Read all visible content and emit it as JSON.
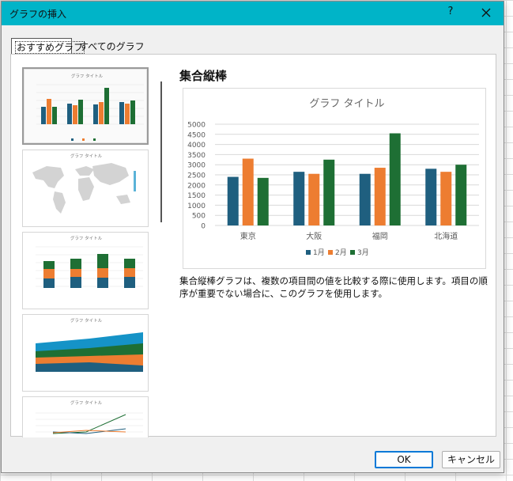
{
  "dialog": {
    "title": "グラフの挿入",
    "help": "?",
    "tabs": [
      "おすすめグラフ",
      "すべてのグラフ"
    ]
  },
  "thumbnails": [
    {
      "title": "グラフ タイトル",
      "kind": "clustered-column"
    },
    {
      "title": "グラフ タイトル",
      "kind": "map"
    },
    {
      "title": "グラフ タイトル",
      "kind": "stacked-column"
    },
    {
      "title": "グラフ タイトル",
      "kind": "stacked-area"
    },
    {
      "title": "グラフ タイトル",
      "kind": "line"
    }
  ],
  "detail": {
    "heading": "集合縦棒",
    "description": "集合縦棒グラフは、複数の項目間の値を比較する際に使用します。項目の順序が重要でない場合に、このグラフを使用します。"
  },
  "chart_data": {
    "type": "bar",
    "title": "グラフ タイトル",
    "categories": [
      "東京",
      "大阪",
      "福岡",
      "北海道"
    ],
    "series": [
      {
        "name": "1月",
        "color": "#1f5f7f",
        "values": [
          2400,
          2650,
          2550,
          2800
        ]
      },
      {
        "name": "2月",
        "color": "#ed7d31",
        "values": [
          3300,
          2550,
          2850,
          2650
        ]
      },
      {
        "name": "3月",
        "color": "#1e6f34",
        "values": [
          2350,
          3250,
          4550,
          3000
        ]
      }
    ],
    "ylim": [
      0,
      5000
    ],
    "yticks": [
      "5000",
      "4500",
      "4000",
      "3500",
      "3000",
      "2500",
      "2000",
      "1500",
      "1000",
      "500",
      "0"
    ],
    "grid": true,
    "legend": "bottom"
  },
  "buttons": {
    "ok": "OK",
    "cancel": "キャンセル"
  },
  "colors": {
    "titlebar": "#00b4c8",
    "series1": "#1f5f7f",
    "series2": "#ed7d31",
    "series3": "#1e6f34",
    "thumb_blue": "#1593c7"
  }
}
